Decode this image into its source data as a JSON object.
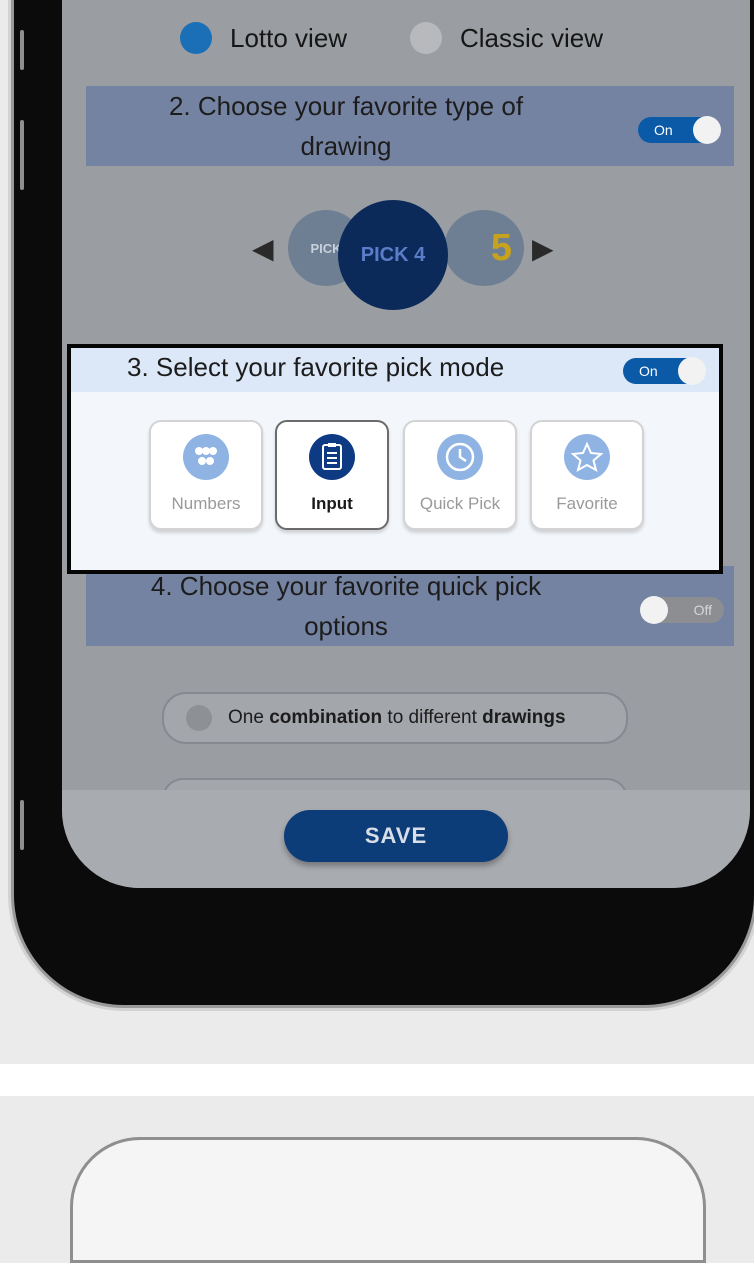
{
  "view_options": {
    "lotto": "Lotto view",
    "classic": "Classic view",
    "selected": "lotto"
  },
  "section2": {
    "title": "2. Choose your favorite type of drawing",
    "toggle": "On",
    "carousel": {
      "items": [
        "PICK",
        "PICK 4",
        "5"
      ],
      "selected_index": 1
    }
  },
  "section3": {
    "title": "3. Select your favorite pick mode",
    "toggle": "On",
    "modes": [
      {
        "label": "Numbers",
        "icon": "dots-icon"
      },
      {
        "label": "Input",
        "icon": "clipboard-icon"
      },
      {
        "label": "Quick Pick",
        "icon": "clock-icon"
      },
      {
        "label": "Favorite",
        "icon": "star-icon"
      }
    ],
    "selected_mode": "Input"
  },
  "section4": {
    "title": "4. Choose your favorite quick pick options",
    "toggle": "Off",
    "option1": {
      "prefix": "One ",
      "bold1": "combination",
      "middle": " to different ",
      "bold2": "drawings"
    }
  },
  "save_button": "SAVE",
  "colors": {
    "accent": "#0b5aa8",
    "save": "#0d3d78",
    "highlight_header": "#dce8f8",
    "icon_blue": "#5b8fd0"
  }
}
